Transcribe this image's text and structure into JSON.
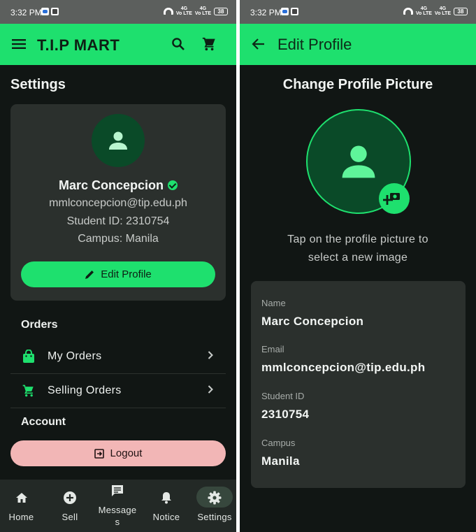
{
  "status": {
    "time": "3:32 PM",
    "battery": "38",
    "net1": "Vo LTE",
    "net1_sig": "4G",
    "net2": "Vo LTE",
    "net2_sig": "4G"
  },
  "left": {
    "app_title": "T.I.P MART",
    "section_title": "Settings",
    "profile": {
      "name": "Marc Concepcion",
      "email": "mmlconcepcion@tip.edu.ph",
      "student_id": "Student ID: 2310754",
      "campus": "Campus: Manila",
      "edit_label": "Edit Profile"
    },
    "orders_title": "Orders",
    "orders_items": [
      {
        "label": "My Orders",
        "icon": "shopping-bag-icon"
      },
      {
        "label": "Selling Orders",
        "icon": "cart-icon"
      }
    ],
    "account_title": "Account",
    "logout_label": "Logout",
    "nav": [
      {
        "label": "Home",
        "icon": "home-icon"
      },
      {
        "label": "Sell",
        "icon": "add-circle-icon"
      },
      {
        "label": "Message s",
        "icon": "message-icon"
      },
      {
        "label": "Notice",
        "icon": "bell-icon"
      },
      {
        "label": "Settings",
        "icon": "gear-icon",
        "active": true
      }
    ]
  },
  "right": {
    "app_title": "Edit Profile",
    "title": "Change Profile Picture",
    "hint": "Tap on the profile picture to select a new image",
    "fields": [
      {
        "label": "Name",
        "value": "Marc Concepcion"
      },
      {
        "label": "Email",
        "value": "mmlconcepcion@tip.edu.ph"
      },
      {
        "label": "Student ID",
        "value": "2310754"
      },
      {
        "label": "Campus",
        "value": "Manila"
      }
    ]
  },
  "colors": {
    "accent": "#1ee06e",
    "background": "#111614",
    "card": "#2b302d",
    "logout": "#f2b6b6",
    "avatar": "#0a4a28"
  }
}
